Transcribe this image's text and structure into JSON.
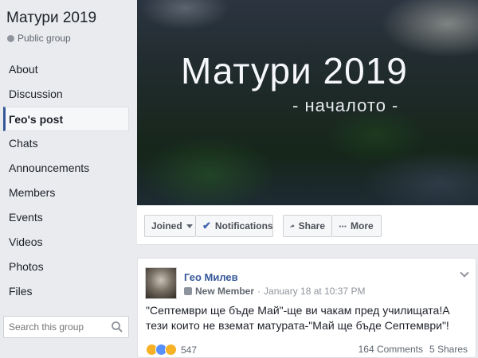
{
  "group": {
    "title": "Матури 2019",
    "type": "Public group"
  },
  "nav": [
    {
      "label": "About"
    },
    {
      "label": "Discussion"
    },
    {
      "label": "Гео's post"
    },
    {
      "label": "Chats"
    },
    {
      "label": "Announcements"
    },
    {
      "label": "Members"
    },
    {
      "label": "Events"
    },
    {
      "label": "Videos"
    },
    {
      "label": "Photos"
    },
    {
      "label": "Files"
    }
  ],
  "search": {
    "placeholder": "Search this group"
  },
  "cover": {
    "title": "Матури 2019",
    "subtitle": "- началото -"
  },
  "actions": {
    "joined": "Joined",
    "notifications": "Notifications",
    "share": "Share",
    "more": "More"
  },
  "post": {
    "author": "Гео Милев",
    "badge": "New Member",
    "separator": "·",
    "timestamp": "January 18 at 10:37 PM",
    "text": "\"Септември ще бъде Май\"-ще ви чакам пред училищата!А тези които не вземат матурата-\"Май ще бъде Септември\"!",
    "reactions_count": "547",
    "comments": "164 Comments",
    "shares": "5 Shares"
  }
}
